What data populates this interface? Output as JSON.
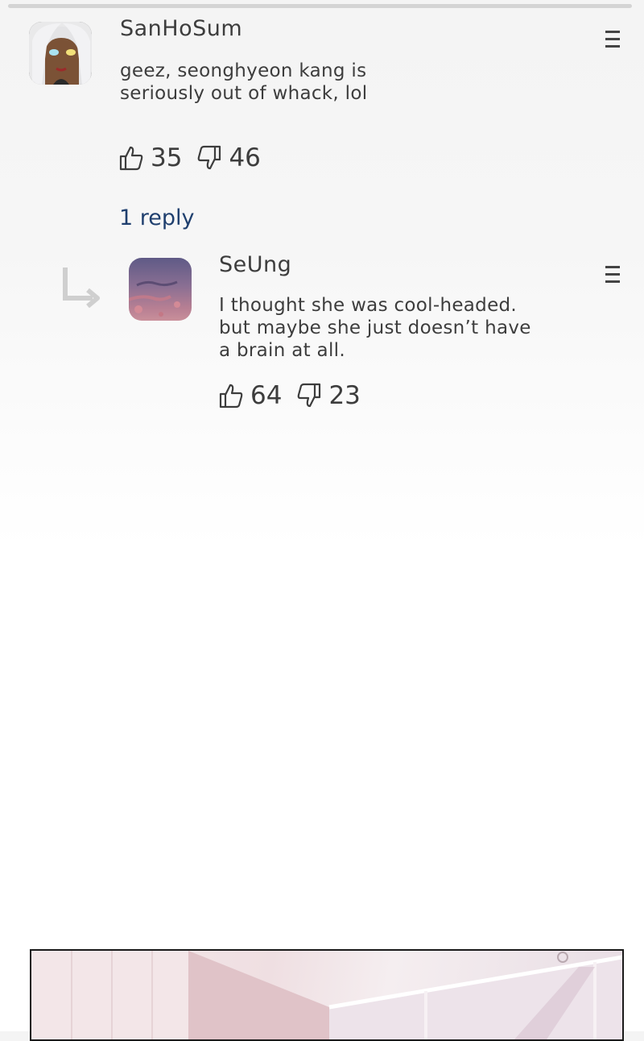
{
  "comment": {
    "username": "SanHoSum",
    "text_line1": "geez, seonghyeon kang is",
    "text_line2": "seriously out of whack, lol",
    "likes": "35",
    "dislikes": "46",
    "replies_link": "1 reply"
  },
  "reply": {
    "username": "SeUng",
    "text_line1": "I thought she was cool-headed.",
    "text_line2": "but maybe she just doesn’t have",
    "text_line3": "a brain at all.",
    "likes": "64",
    "dislikes": "23"
  },
  "icons": {
    "like": "thumbs-up-icon",
    "dislike": "thumbs-down-icon",
    "menu": "more-menu-icon",
    "reply_arrow": "reply-arrow-icon"
  },
  "colors": {
    "link": "#1f3f6e",
    "text": "#3d3d3d"
  }
}
